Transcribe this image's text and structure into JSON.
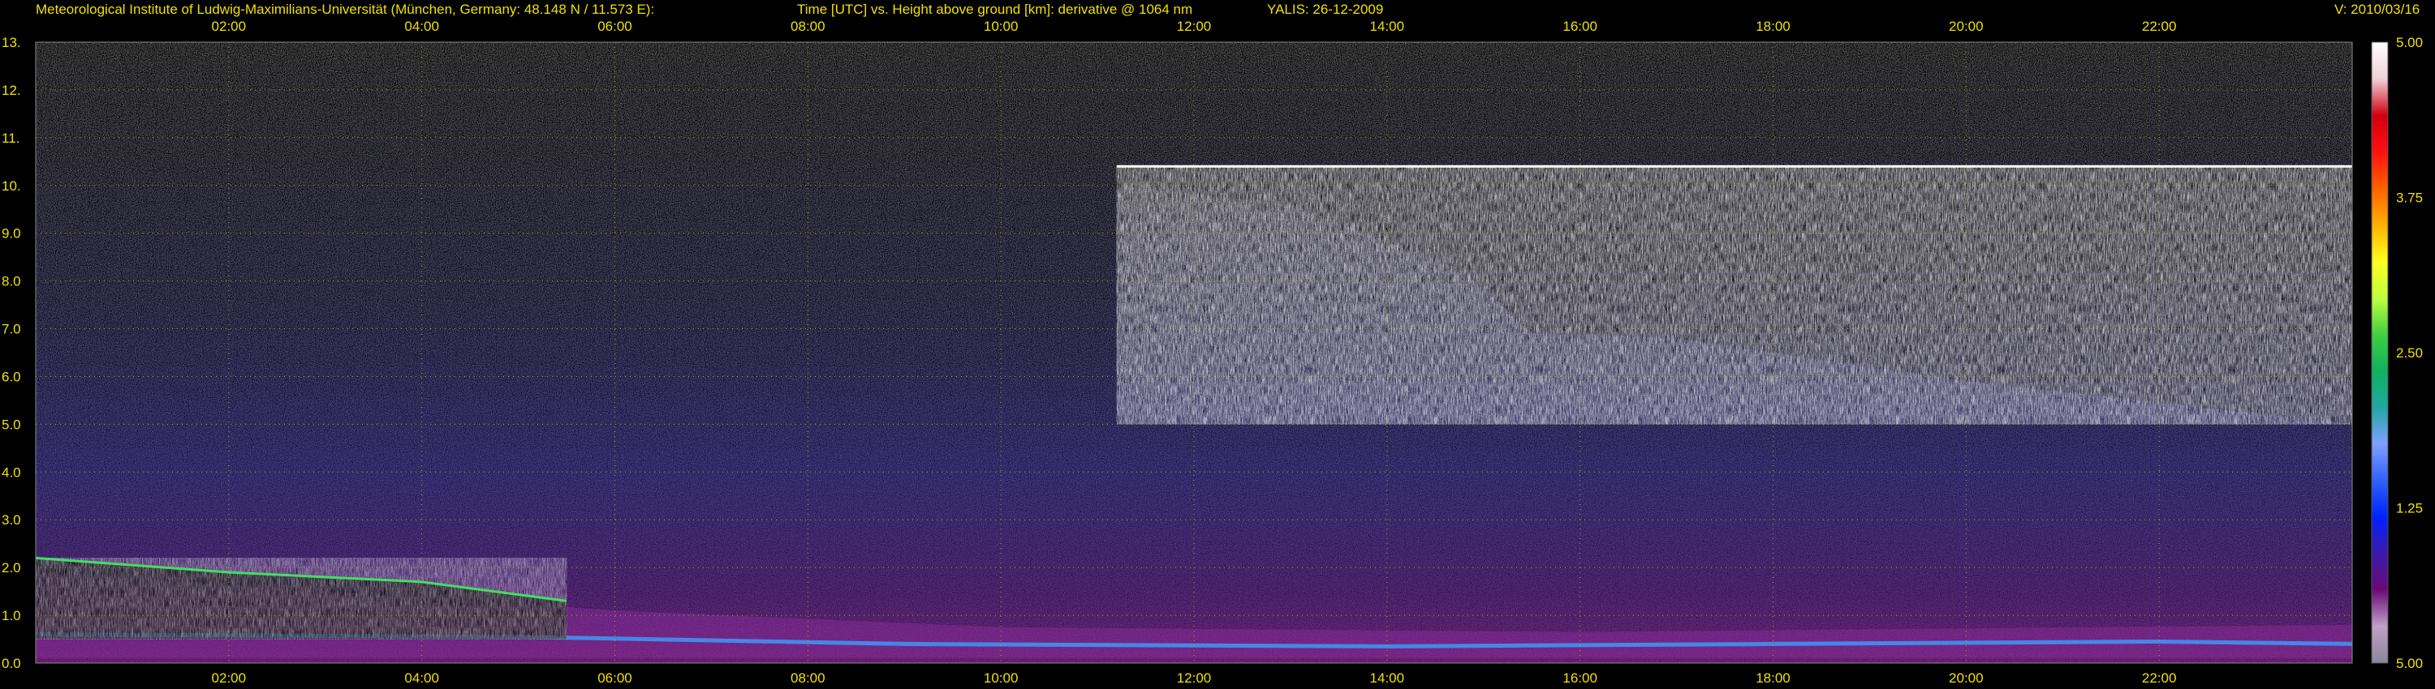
{
  "header": {
    "institute": "Meteorological Institute of Ludwig-Maximilians-Universität (München, Germany: 48.148 N / 11.573 E):",
    "plot_title": "Time [UTC] vs. Height above ground [km]: derivative @ 1064 nm",
    "system_date": "YALIS: 26-12-2009",
    "version": "V: 2010/03/16"
  },
  "colors": {
    "header_text": "#f0e000",
    "axis_text": "#f0e000",
    "grid": "#c8c400",
    "background": "#000000"
  },
  "chart_data": {
    "type": "heatmap",
    "title": "Time [UTC] vs. Height above ground [km]: derivative @ 1064 nm",
    "xlabel": "Time [UTC]",
    "ylabel": "Height above ground [km]",
    "x_ticks": [
      "02:00",
      "04:00",
      "06:00",
      "08:00",
      "10:00",
      "12:00",
      "14:00",
      "16:00",
      "18:00",
      "20:00",
      "22:00"
    ],
    "x_tick_hours": [
      2,
      4,
      6,
      8,
      10,
      12,
      14,
      16,
      18,
      20,
      22
    ],
    "xlim_hours": [
      0,
      24
    ],
    "y_ticks": [
      "0.0",
      "1.0",
      "2.0",
      "3.0",
      "4.0",
      "5.0",
      "6.0",
      "7.0",
      "8.0",
      "9.0",
      "10.",
      "11.",
      "12.",
      "13."
    ],
    "y_tick_values": [
      0,
      1,
      2,
      3,
      4,
      5,
      6,
      7,
      8,
      9,
      10,
      11,
      12,
      13
    ],
    "ylim_km": [
      0,
      13
    ],
    "grid": true,
    "colorbar": {
      "ticks": [
        "5.00",
        "3.75",
        "2.50",
        "1.25",
        "5.00"
      ],
      "tick_values": [
        5.0,
        3.75,
        2.5,
        1.25,
        0.0
      ],
      "range": [
        0,
        5
      ],
      "stops": [
        "#8a8898",
        "#c0a0c8",
        "#6a0a78",
        "#3a1aa8",
        "#0022ff",
        "#3060ff",
        "#80a0ff",
        "#20a8a0",
        "#10b060",
        "#40d040",
        "#c0ff40",
        "#ffff20",
        "#ffb000",
        "#ff6000",
        "#ff1010",
        "#d00010",
        "#f0d0d8",
        "#ffffff"
      ]
    },
    "features": {
      "cirrus_layer": {
        "start_hour": 11.2,
        "end_hour": 24,
        "top_km": 10.4,
        "base_start_km": 10.0,
        "base_end_km": 5.0
      },
      "low_cloud": {
        "start_hour": 0,
        "end_hour": 5.5,
        "top_km": 2.2,
        "base_km": 0.5
      },
      "boundary_layer": {
        "start_hour": 0,
        "end_hour": 24,
        "top_km": 1.9
      }
    }
  }
}
